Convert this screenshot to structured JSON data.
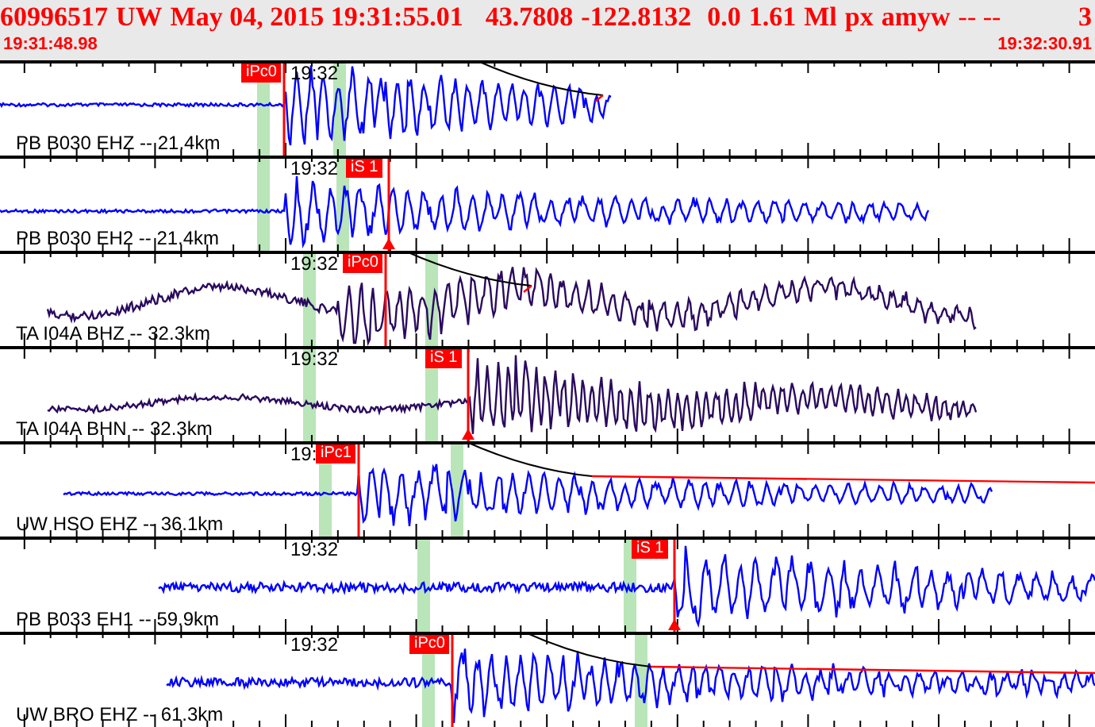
{
  "header": {
    "event_id": "60996517",
    "network": "UW",
    "datetime": "May 04, 2015 19:31:55.01",
    "latitude": "43.7808",
    "longitude": "-122.8132",
    "depth": "0.0",
    "magnitude": "1.61",
    "magnitude_type": "Ml",
    "source": "px",
    "author": "amyw",
    "flags": "-- --",
    "count": "3",
    "start_time": "19:31:48.98",
    "end_time": "19:32:30.91"
  },
  "panels": [
    {
      "station": "PB B030 EHZ -- 21.4km",
      "time_label": "19:32",
      "color": "#0000ff",
      "pick": {
        "label": "iPc0",
        "kind": "p"
      }
    },
    {
      "station": "PB B030 EH2 -- 21.4km",
      "time_label": "19:32",
      "color": "#0000ff",
      "pick": {
        "label": "iS 1",
        "kind": "s"
      }
    },
    {
      "station": "TA I04A BHZ -- 32.3km",
      "time_label": "19:32",
      "color": "#2a0a5e",
      "pick": {
        "label": "iPc0",
        "kind": "p"
      }
    },
    {
      "station": "TA I04A BHN -- 32.3km",
      "time_label": "19:32",
      "color": "#2a0a5e",
      "pick": {
        "label": "iS 1",
        "kind": "s"
      }
    },
    {
      "station": "UW HSO EHZ -- 36.1km",
      "time_label": "19:",
      "color": "#0000ff",
      "pick": {
        "label": "iPc1",
        "kind": "p"
      }
    },
    {
      "station": "PB B033 EH1 -- 59.9km",
      "time_label": "19:32",
      "color": "#0000ff",
      "pick": {
        "label": "iS 1",
        "kind": "s"
      }
    },
    {
      "station": "UW BRO EHZ -- 61.3km",
      "time_label": "19:32",
      "color": "#0000ff",
      "pick": {
        "label": "iPc0",
        "kind": "p"
      }
    }
  ]
}
